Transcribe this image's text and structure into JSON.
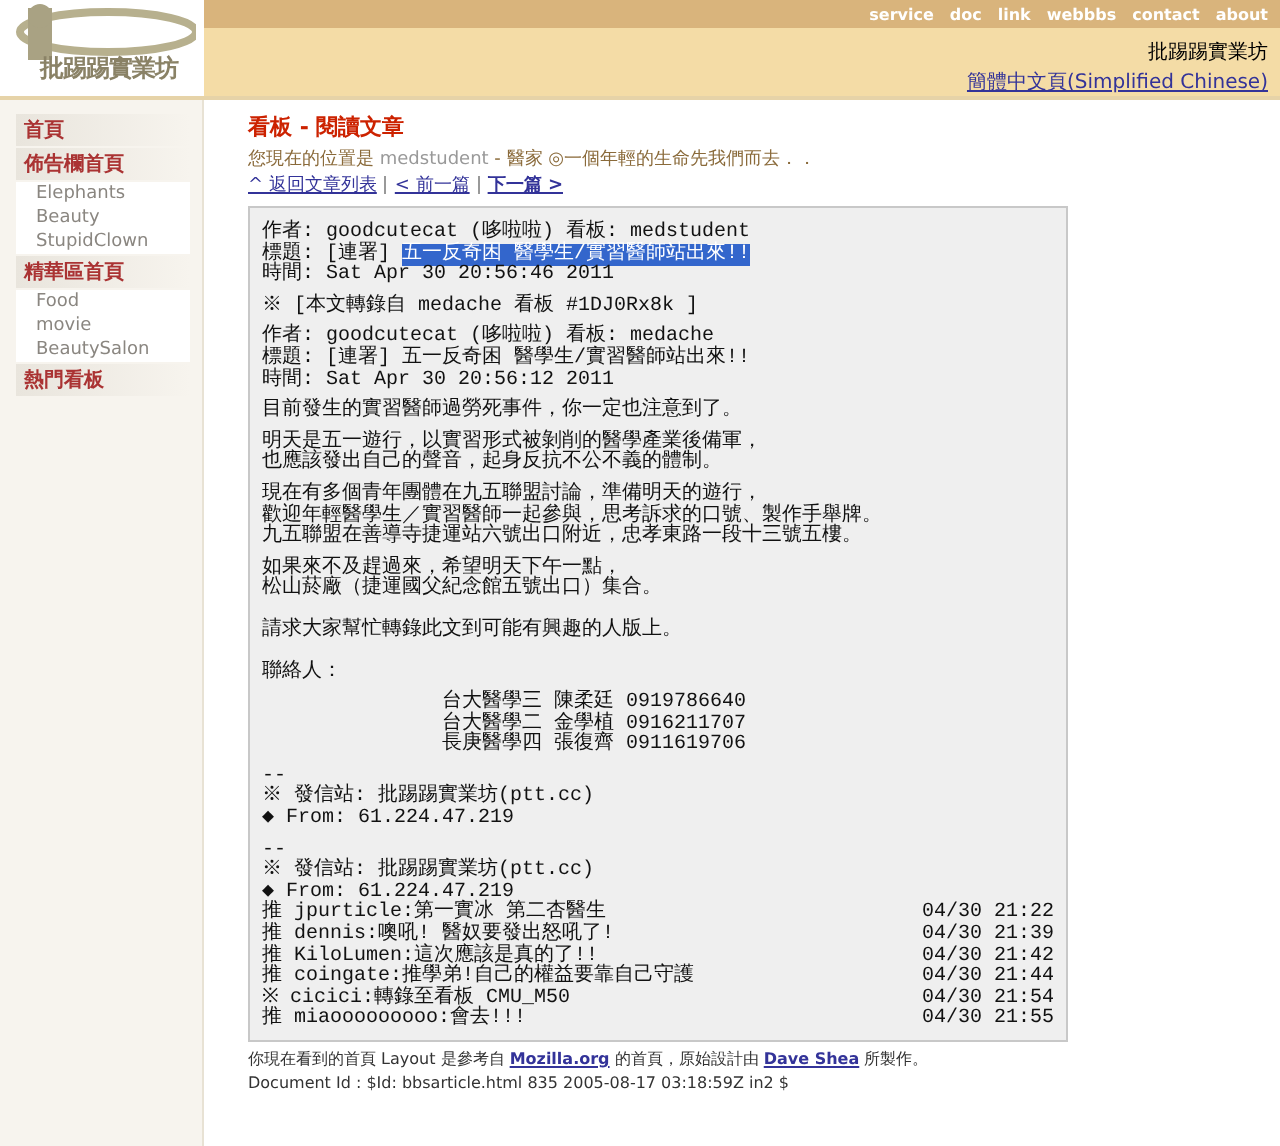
{
  "header": {
    "logo_text": "批踢踢實業坊",
    "nav_links": [
      "service",
      "doc",
      "link",
      "webbbs",
      "contact",
      "about"
    ],
    "site_name": "批踢踢實業坊",
    "language_link": "簡體中文頁(Simplified Chinese)"
  },
  "sidebar": {
    "items": [
      {
        "label": "首頁"
      },
      {
        "label": "佈告欄首頁",
        "children": [
          {
            "label": "Elephants"
          },
          {
            "label": "Beauty"
          },
          {
            "label": "StupidClown"
          }
        ]
      },
      {
        "label": "精華區首頁",
        "children": [
          {
            "label": "Food"
          },
          {
            "label": "movie"
          },
          {
            "label": "BeautySalon"
          }
        ]
      },
      {
        "label": "熱門看板"
      }
    ]
  },
  "page_title": "看板 - 閱讀文章",
  "location": {
    "prefix": "您現在的位置是",
    "board": "medstudent",
    "rest": "- 醫家 ◎一個年輕的生命先我們而去．．"
  },
  "nav": [
    {
      "label": "^ 返回文章列表",
      "emphasized": false
    },
    {
      "label": "< 前一篇",
      "emphasized": false
    },
    {
      "label": "下一篇 >",
      "emphasized": true
    }
  ],
  "article": {
    "lines": [
      {
        "kind": "text",
        "text": "作者: goodcutecat (哆啦啦) 看板: medstudent"
      },
      {
        "kind": "selection",
        "text": "標題: [連署] ",
        "selected_text": "五一反奇困 醫學生/實習醫師站出來!!"
      },
      {
        "kind": "text",
        "text": "時間: Sat Apr 30 20:56:46 2011"
      },
      {
        "kind": "blank"
      },
      {
        "kind": "text",
        "text": "※ [本文轉錄自 medache 看板 #1DJ0Rx8k ]"
      },
      {
        "kind": "blank"
      },
      {
        "kind": "text",
        "text": "作者: goodcutecat (哆啦啦) 看板: medache"
      },
      {
        "kind": "text",
        "text": "標題: [連署] 五一反奇困 醫學生/實習醫師站出來!!"
      },
      {
        "kind": "text",
        "text": "時間: Sat Apr 30 20:56:12 2011"
      },
      {
        "kind": "blank"
      },
      {
        "kind": "text",
        "text": "目前發生的實習醫師過勞死事件，你一定也注意到了。"
      },
      {
        "kind": "blank"
      },
      {
        "kind": "text",
        "text": "明天是五一遊行，以實習形式被剝削的醫學產業後備軍，"
      },
      {
        "kind": "text",
        "text": "也應該發出自己的聲音，起身反抗不公不義的體制。"
      },
      {
        "kind": "blank"
      },
      {
        "kind": "text",
        "text": "現在有多個青年團體在九五聯盟討論，準備明天的遊行，"
      },
      {
        "kind": "text",
        "text": "歡迎年輕醫學生／實習醫師一起參與，思考訴求的口號、製作手舉牌。"
      },
      {
        "kind": "text",
        "text": "九五聯盟在善導寺捷運站六號出口附近，忠孝東路一段十三號五樓。"
      },
      {
        "kind": "blank"
      },
      {
        "kind": "text",
        "text": "如果來不及趕過來，希望明天下午一點，"
      },
      {
        "kind": "text",
        "text": "松山菸廠（捷運國父紀念館五號出口）集合。"
      },
      {
        "kind": "blank"
      },
      {
        "kind": "blank"
      },
      {
        "kind": "text",
        "text": "請求大家幫忙轉錄此文到可能有興趣的人版上。"
      },
      {
        "kind": "blank"
      },
      {
        "kind": "blank"
      },
      {
        "kind": "text",
        "text": "聯絡人："
      },
      {
        "kind": "blank"
      },
      {
        "kind": "indent",
        "text": "台大醫學三 陳柔廷 0919786640"
      },
      {
        "kind": "indent",
        "text": "台大醫學二 金學植 0916211707"
      },
      {
        "kind": "indent",
        "text": "長庚醫學四 張復齊 0911619706"
      },
      {
        "kind": "blank"
      },
      {
        "kind": "text",
        "text": "--"
      },
      {
        "kind": "text",
        "text": "※ 發信站: 批踢踢實業坊(ptt.cc)"
      },
      {
        "kind": "text",
        "text": "◆ From: 61.224.47.219"
      },
      {
        "kind": "blank"
      },
      {
        "kind": "text",
        "text": "--"
      },
      {
        "kind": "text",
        "text": "※ 發信站: 批踢踢實業坊(ptt.cc)"
      },
      {
        "kind": "text",
        "text": "◆ From: 61.224.47.219"
      },
      {
        "kind": "push",
        "text": "推 jpurticle:第一實冰 第二杏醫生",
        "time": "04/30 21:22"
      },
      {
        "kind": "push",
        "text": "推 dennis:噢吼! 醫奴要發出怒吼了!",
        "time": "04/30 21:39"
      },
      {
        "kind": "push",
        "text": "推 KiloLumen:這次應該是真的了!!",
        "time": "04/30 21:42"
      },
      {
        "kind": "push",
        "text": "推 coingate:推學弟!自己的權益要靠自己守護",
        "time": "04/30 21:44"
      },
      {
        "kind": "push",
        "text": "※ cicici:轉錄至看板 CMU_M50",
        "time": "04/30 21:54"
      },
      {
        "kind": "push",
        "text": "推 miaooooooooo:會去!!!",
        "time": "04/30 21:55"
      }
    ]
  },
  "footer": {
    "credit": {
      "before": "你現在看到的首頁 Layout 是參考自 ",
      "link_1": "Mozilla.org",
      "middle": " 的首頁，原始設計由 ",
      "link_2": "Dave Shea",
      "after": " 所製作。"
    },
    "document_id": "Document Id : $Id: bbsarticle.html 835 2005-08-17 03:18:59Z in2 $"
  }
}
